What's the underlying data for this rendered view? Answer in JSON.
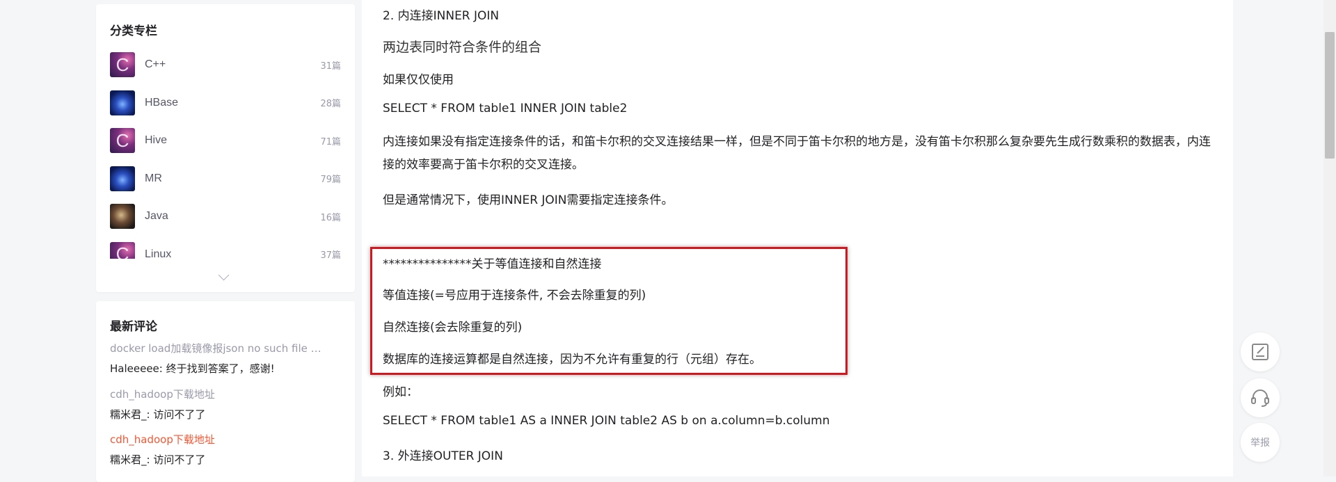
{
  "sidebar": {
    "categories": {
      "title": "分类专栏",
      "items": [
        {
          "name": "C++",
          "count": "31篇",
          "icon": "c-icon"
        },
        {
          "name": "HBase",
          "count": "28篇",
          "icon": "galaxy-icon"
        },
        {
          "name": "Hive",
          "count": "71篇",
          "icon": "c-icon"
        },
        {
          "name": "MR",
          "count": "79篇",
          "icon": "galaxy-icon"
        },
        {
          "name": "Java",
          "count": "16篇",
          "icon": "java-icon"
        },
        {
          "name": "Linux",
          "count": "37篇",
          "icon": "c-icon"
        }
      ]
    },
    "comments": {
      "title": "最新评论",
      "items": [
        {
          "link": "docker load加载镜像报json no such file …",
          "text": "Haleeeee: 终于找到答案了，感谢!"
        },
        {
          "link": "cdh_hadoop下载地址",
          "text": "糯米君_: 访问不了了"
        },
        {
          "link": "cdh_hadoop下载地址",
          "text": "糯米君_: 访问不了了"
        }
      ]
    }
  },
  "article": {
    "h2": "2. 内连接INNER JOIN",
    "subtitle": "两边表同时符合条件的组合",
    "p_only": "如果仅仅使用",
    "code1": "SELECT * FROM table1 INNER JOIN table2",
    "p_cartesian": "内连接如果没有指定连接条件的话，和笛卡尔积的交叉连接结果一样，但是不同于笛卡尔积的地方是，没有笛卡尔积那么复杂要先生成行数乘积的数据表，内连接的效率要高于笛卡尔积的交叉连接。",
    "p_usually": "但是通常情况下，使用INNER JOIN需要指定连接条件。",
    "note_title": "***************关于等值连接和自然连接",
    "note_equi": "等值连接(=号应用于连接条件, 不会去除重复的列)",
    "note_natural": "自然连接(会去除重复的列)",
    "note_db": "数据库的连接运算都是自然连接，因为不允许有重复的行（元组）存在。",
    "example": "例如：",
    "code2": "SELECT * FROM table1 AS a INNER JOIN table2 AS b on a.column=b.column",
    "h3": "3. 外连接OUTER JOIN"
  },
  "toolbar": {
    "report_label": "举报"
  },
  "colors": {
    "highlight_border": "#d2171e",
    "active_link": "#fc5531"
  }
}
